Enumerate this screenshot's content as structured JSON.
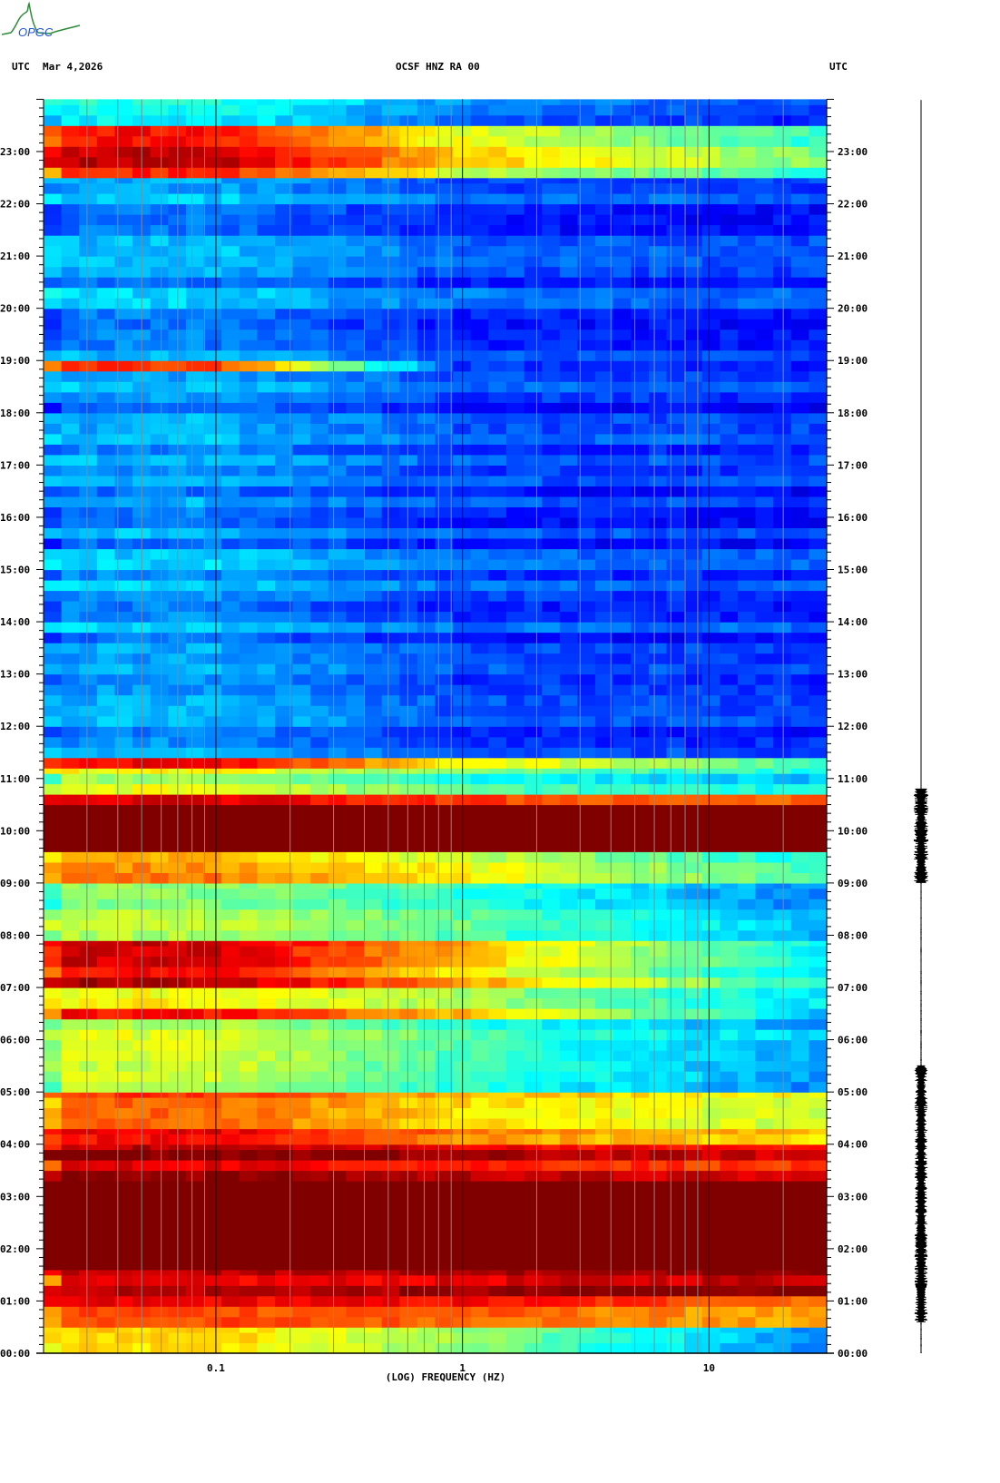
{
  "header": {
    "left_tz": "UTC",
    "date": "Mar 4,2026",
    "station": "OCSF HNZ RA 00",
    "right_tz": "UTC"
  },
  "logo": {
    "text": "OPGC"
  },
  "chart_data": {
    "type": "heatmap",
    "title": "OCSF HNZ RA 00",
    "xlabel": "(LOG) FREQUENCY (HZ)",
    "ylabel": "UTC",
    "x_scale": "log",
    "xlim": [
      0.02,
      30
    ],
    "ylim_hours": [
      0,
      24
    ],
    "x_tick_labels": [
      {
        "value": 0.1,
        "label": "0.1"
      },
      {
        "value": 1,
        "label": "1"
      },
      {
        "value": 10,
        "label": "10"
      }
    ],
    "y_tick_labels": [
      "00:00",
      "01:00",
      "02:00",
      "03:00",
      "04:00",
      "05:00",
      "06:00",
      "07:00",
      "08:00",
      "09:00",
      "10:00",
      "11:00",
      "12:00",
      "13:00",
      "14:00",
      "15:00",
      "16:00",
      "17:00",
      "18:00",
      "19:00",
      "20:00",
      "21:00",
      "22:00",
      "23:00"
    ],
    "colormap": "jet",
    "intensity_bands": [
      {
        "from": 0.0,
        "to": 0.5,
        "low": 0.6,
        "mid": 0.45,
        "high": 0.15
      },
      {
        "from": 0.5,
        "to": 1.1,
        "low": 0.82,
        "mid": 0.8,
        "high": 0.7
      },
      {
        "from": 1.1,
        "to": 1.6,
        "low": 0.93,
        "mid": 0.95,
        "high": 1.0
      },
      {
        "from": 1.6,
        "to": 3.3,
        "low": 1.0,
        "mid": 1.0,
        "high": 1.0
      },
      {
        "from": 3.3,
        "to": 4.0,
        "low": 0.95,
        "mid": 0.9,
        "high": 0.85
      },
      {
        "from": 4.0,
        "to": 4.3,
        "low": 0.85,
        "mid": 0.7,
        "high": 0.6
      },
      {
        "from": 4.3,
        "to": 5.0,
        "low": 0.78,
        "mid": 0.65,
        "high": 0.55
      },
      {
        "from": 5.0,
        "to": 6.0,
        "low": 0.55,
        "mid": 0.4,
        "high": 0.22
      },
      {
        "from": 6.0,
        "to": 6.4,
        "low": 0.55,
        "mid": 0.4,
        "high": 0.25
      },
      {
        "from": 6.4,
        "to": 6.6,
        "low": 0.9,
        "mid": 0.7,
        "high": 0.3
      },
      {
        "from": 6.6,
        "to": 7.0,
        "low": 0.55,
        "mid": 0.45,
        "high": 0.25
      },
      {
        "from": 7.0,
        "to": 7.9,
        "low": 0.9,
        "mid": 0.65,
        "high": 0.3
      },
      {
        "from": 7.9,
        "to": 9.0,
        "low": 0.5,
        "mid": 0.4,
        "high": 0.22
      },
      {
        "from": 9.0,
        "to": 9.6,
        "low": 0.68,
        "mid": 0.55,
        "high": 0.35
      },
      {
        "from": 9.6,
        "to": 10.5,
        "low": 1.0,
        "mid": 1.0,
        "high": 1.0
      },
      {
        "from": 10.5,
        "to": 10.7,
        "low": 0.85,
        "mid": 0.75,
        "high": 0.7
      },
      {
        "from": 10.7,
        "to": 11.2,
        "low": 0.55,
        "mid": 0.4,
        "high": 0.3
      },
      {
        "from": 11.2,
        "to": 11.4,
        "low": 0.82,
        "mid": 0.55,
        "high": 0.35
      },
      {
        "from": 11.4,
        "to": 18.8,
        "low": 0.22,
        "mid": 0.12,
        "high": 0.1
      },
      {
        "from": 18.8,
        "to": 19.0,
        "low": 0.85,
        "mid": 0.15,
        "high": 0.1
      },
      {
        "from": 19.0,
        "to": 22.5,
        "low": 0.22,
        "mid": 0.12,
        "high": 0.1
      },
      {
        "from": 22.5,
        "to": 23.5,
        "low": 0.88,
        "mid": 0.6,
        "high": 0.4
      },
      {
        "from": 23.5,
        "to": 24.0,
        "low": 0.35,
        "mid": 0.2,
        "high": 0.12
      }
    ],
    "trace_envelope": [
      {
        "from": 0.0,
        "to": 0.6,
        "amplitude": 0.08
      },
      {
        "from": 0.6,
        "to": 5.5,
        "amplitude": 0.8
      },
      {
        "from": 5.5,
        "to": 9.0,
        "amplitude": 0.08
      },
      {
        "from": 9.0,
        "to": 10.8,
        "amplitude": 0.9
      },
      {
        "from": 10.8,
        "to": 24.0,
        "amplitude": 0.05
      }
    ]
  }
}
